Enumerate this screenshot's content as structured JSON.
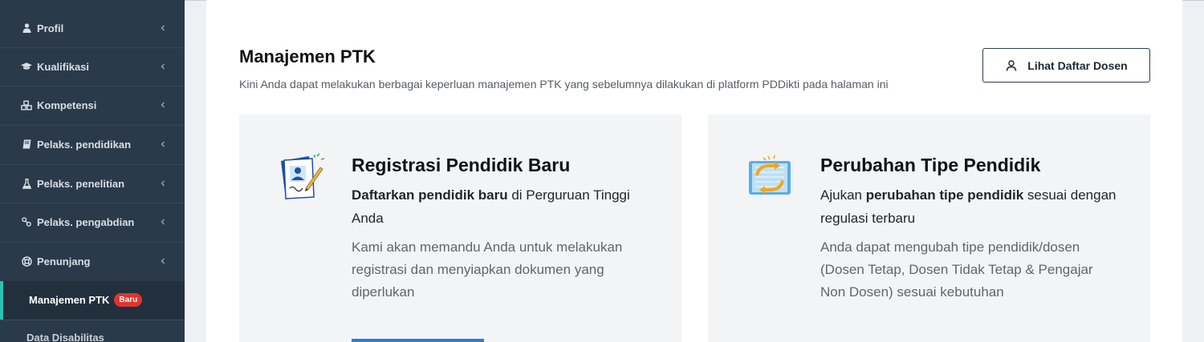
{
  "sidebar": {
    "items": [
      {
        "label": "Profil",
        "icon": "user-icon"
      },
      {
        "label": "Kualifikasi",
        "icon": "graduation-cap-icon"
      },
      {
        "label": "Kompetensi",
        "icon": "cubes-icon"
      },
      {
        "label": "Pelaks. pendidikan",
        "icon": "book-icon"
      },
      {
        "label": "Pelaks. penelitian",
        "icon": "flask-icon"
      },
      {
        "label": "Pelaks. pengabdian",
        "icon": "link-icon"
      },
      {
        "label": "Penunjang",
        "icon": "life-ring-icon"
      }
    ],
    "active": {
      "label": "Manajemen PTK",
      "badge": "Baru"
    },
    "next_item": "Data Disabilitas",
    "accent": "#2bc1b0"
  },
  "header": {
    "title": "Manajemen PTK",
    "subtitle": "Kini Anda dapat melakukan berbagai keperluan manajemen PTK yang sebelumnya dilakukan di platform PDDikti pada halaman ini",
    "button_label": "Lihat Daftar Dosen"
  },
  "cards": [
    {
      "title": "Registrasi Pendidik Baru",
      "lead_bold": "Daftarkan pendidik baru",
      "lead_rest": " di Perguruan Tinggi Anda",
      "description": "Kami akan memandu Anda untuk melakukan registrasi dan menyiapkan dokumen yang diperlukan",
      "icon": "registration-form-icon"
    },
    {
      "title": "Perubahan Tipe Pendidik",
      "lead_pre": "Ajukan ",
      "lead_bold": "perubahan tipe pendidik",
      "lead_rest": " sesuai dengan regulasi terbaru",
      "description": "Anda dapat mengubah tipe pendidik/dosen (Dosen Tetap, Dosen Tidak Tetap & Pengajar Non Dosen) sesuai kebutuhan",
      "icon": "exchange-document-icon"
    }
  ]
}
